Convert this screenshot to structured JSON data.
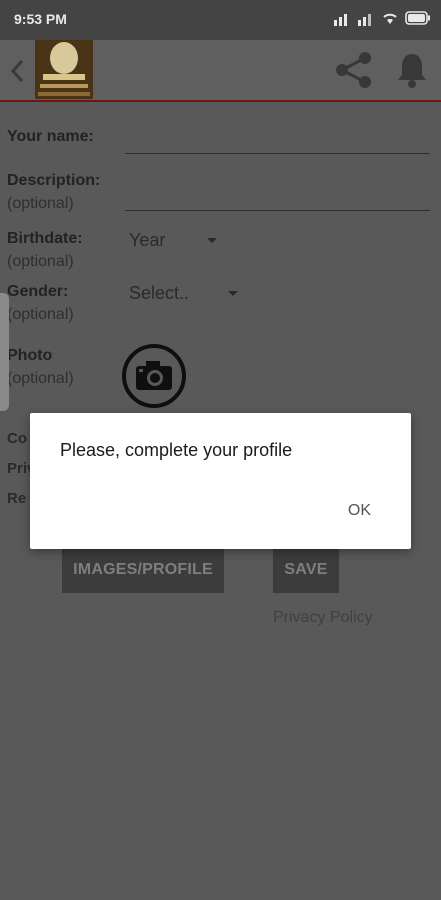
{
  "status_bar": {
    "time": "9:53 PM",
    "icons": [
      "signal-icon",
      "signal-icon",
      "wifi-icon",
      "battery-icon"
    ]
  },
  "toolbar": {
    "back_icon": "chevron-left-icon",
    "share_icon": "share-icon",
    "notifications_icon": "bell-icon"
  },
  "form": {
    "name_label": "Your name:",
    "description_label": "Description:",
    "optional": "(optional)",
    "birthdate_label": "Birthdate:",
    "birthdate_value": "Year",
    "gender_label": "Gender:",
    "gender_value": "Select..",
    "photo_label": "Photo",
    "photo_icon": "camera-icon"
  },
  "partially_hidden_labels": [
    "Co",
    "Priv",
    "Re"
  ],
  "actions": {
    "images_profile": "IMAGES/PROFILE",
    "save": "SAVE",
    "privacy_policy": "Privacy Policy"
  },
  "dialog": {
    "message": "Please, complete your profile",
    "ok": "OK"
  },
  "colors": {
    "dim_background": "#595959",
    "toolbar_accent": "#6e1515",
    "dialog_background": "#ffffff"
  }
}
